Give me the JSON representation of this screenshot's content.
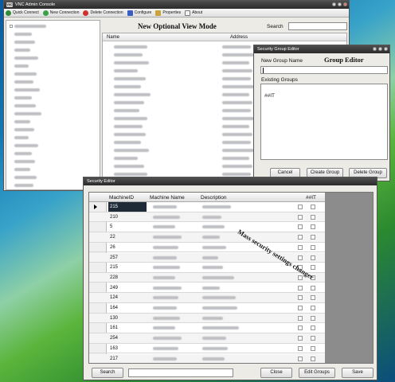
{
  "main_window": {
    "title": "VNC Admin Console",
    "toolbar": [
      "Quick Connect",
      "New Connection",
      "Delete Connection",
      "Configure",
      "Properties",
      "About"
    ],
    "view_title": "New Optional View Mode",
    "search_label": "Search",
    "columns": [
      "Name",
      "Address"
    ]
  },
  "group_editor": {
    "window_title": "Security Group Editor",
    "new_group_label": "New Group Name",
    "heading": "Group Editor",
    "existing_label": "Existing Groups",
    "groups": [
      "##IT"
    ],
    "buttons": [
      "Cancel",
      "Create Group",
      "Delete Group"
    ]
  },
  "security_editor": {
    "window_title": "Security Editor",
    "columns": [
      "MachineID",
      "Machine Name",
      "Description",
      "##IT"
    ],
    "annotation": "Mass security settings changer",
    "machine_ids": [
      "215",
      "210",
      "5",
      "22",
      "26",
      "257",
      "215",
      "228",
      "249",
      "124",
      "164",
      "130",
      "161",
      "254",
      "163",
      "217"
    ],
    "search_button": "Search",
    "buttons": [
      "Close",
      "Edit Groups",
      "Save"
    ]
  },
  "colors": {
    "accent_title": "#2a2a2a",
    "selected_row": "#1e2a36"
  }
}
